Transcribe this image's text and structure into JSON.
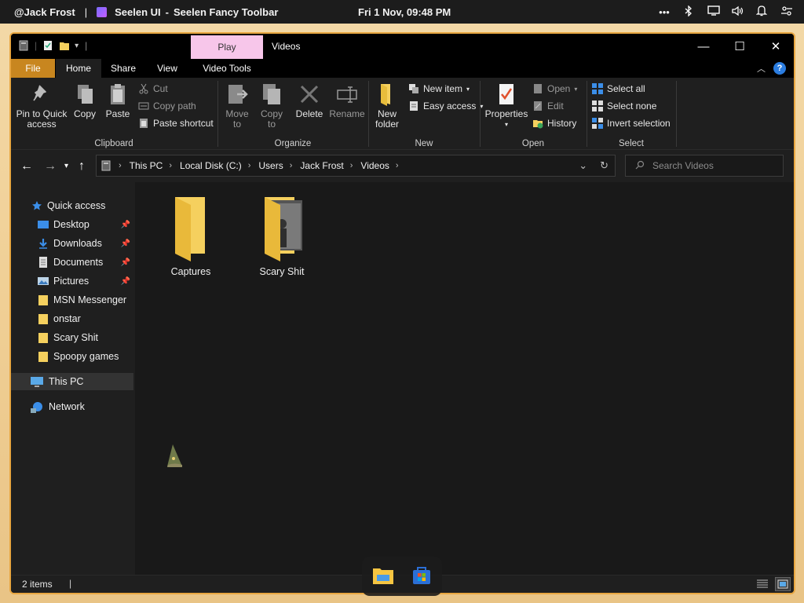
{
  "topbar": {
    "user": "@Jack Frost",
    "separator": "|",
    "app_name": "Seelen UI",
    "separator2": "-",
    "window_name": "Seelen Fancy Toolbar",
    "datetime": "Fri 1 Nov, 09:48 PM",
    "tray_icons": [
      "more-icon",
      "bluetooth-icon",
      "display-icon",
      "volume-icon",
      "bell-icon",
      "settings-toggle-icon"
    ]
  },
  "window": {
    "title": "Videos",
    "contextual_tab": "Play",
    "tabs": [
      "File",
      "Home",
      "Share",
      "View",
      "Video Tools"
    ],
    "help": "?",
    "controls": {
      "minimize": "—",
      "maximize": "☐",
      "close": "✕"
    }
  },
  "ribbon": {
    "clipboard": {
      "label": "Clipboard",
      "pin": "Pin to Quick access",
      "copy": "Copy",
      "paste": "Paste",
      "cut": "Cut",
      "copy_path": "Copy path",
      "paste_shortcut": "Paste shortcut"
    },
    "organize": {
      "label": "Organize",
      "move_to": "Move to",
      "copy_to": "Copy to",
      "delete": "Delete",
      "rename": "Rename"
    },
    "new": {
      "label": "New",
      "new_folder": "New folder",
      "new_item": "New item",
      "easy_access": "Easy access"
    },
    "open": {
      "label": "Open",
      "properties": "Properties",
      "open": "Open",
      "edit": "Edit",
      "history": "History"
    },
    "select": {
      "label": "Select",
      "select_all": "Select all",
      "select_none": "Select none",
      "invert": "Invert selection"
    }
  },
  "address": {
    "crumbs": [
      "This PC",
      "Local Disk (C:)",
      "Users",
      "Jack Frost",
      "Videos"
    ],
    "search_placeholder": "Search Videos"
  },
  "navpane": {
    "quick_access": "Quick access",
    "items": [
      {
        "label": "Desktop",
        "pinned": true
      },
      {
        "label": "Downloads",
        "pinned": true
      },
      {
        "label": "Documents",
        "pinned": true
      },
      {
        "label": "Pictures",
        "pinned": true
      },
      {
        "label": "MSN Messenger",
        "pinned": false
      },
      {
        "label": "onstar",
        "pinned": false
      },
      {
        "label": "Scary Shit",
        "pinned": false
      },
      {
        "label": "Spoopy games",
        "pinned": false
      }
    ],
    "this_pc": "This PC",
    "network": "Network"
  },
  "content": {
    "files": [
      {
        "name": "Captures"
      },
      {
        "name": "Scary Shit"
      }
    ]
  },
  "status": {
    "count": "2 items"
  },
  "colors": {
    "accent": "#e8a640",
    "file_tab": "#c8861f",
    "contextual_tab": "#f7c6ea",
    "folder": "#f5d05e"
  }
}
